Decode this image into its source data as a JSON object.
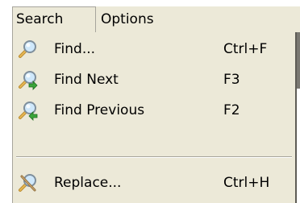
{
  "menubar": {
    "items": [
      {
        "label": "Search"
      },
      {
        "label": "Options"
      }
    ]
  },
  "dropdown": {
    "items": [
      {
        "label": "Find...",
        "shortcut": "Ctrl+F",
        "icon": "magnifier-icon"
      },
      {
        "label": "Find Next",
        "shortcut": "F3",
        "icon": "find-next-icon"
      },
      {
        "label": "Find Previous",
        "shortcut": "F2",
        "icon": "find-previous-icon"
      },
      {
        "label": "Replace...",
        "shortcut": "Ctrl+H",
        "icon": "replace-icon"
      }
    ]
  },
  "colors": {
    "menu_bg": "#ece9d8",
    "border": "#a7a59c",
    "text": "#000000",
    "icon_lens": "#6fb6e9",
    "icon_handle": "#d9a441",
    "icon_green_arrow": "#3aa53a"
  }
}
